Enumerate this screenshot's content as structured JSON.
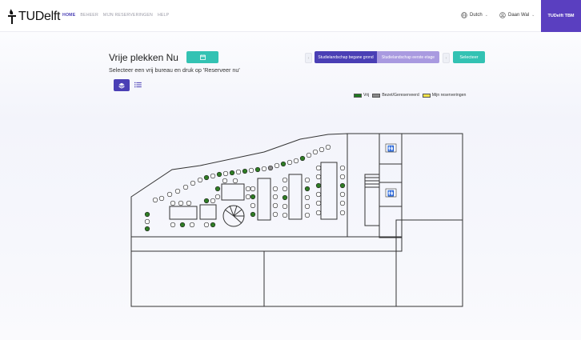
{
  "brand": {
    "name": "TUDelft"
  },
  "nav": {
    "links": [
      "HOME",
      "BEHEER",
      "MIJN RESERVERINGEN",
      "HELP"
    ],
    "language": "Dutch",
    "user": "Daan Wal",
    "tenant": "TUDelft TBM"
  },
  "page": {
    "title": "Vrije plekken Nu",
    "subtitle": "Selecteer een vrij bureau en druk op 'Reserveer nu'",
    "floors": [
      "Studielandschap begane grond",
      "Studielandschap eerste etage"
    ],
    "select_label": "Selecteer"
  },
  "legend": [
    {
      "label": "Vrij",
      "color": "#1f7a1f"
    },
    {
      "label": "Bezet/Gereserveerd",
      "color": "#8a8a8a"
    },
    {
      "label": "Mijn reserveringen",
      "color": "#f2e34a"
    }
  ],
  "icons": {
    "calendar": "calendar-icon",
    "layers": "layers-icon",
    "list": "list-icon",
    "globe": "globe-icon",
    "user": "user-circle-icon"
  }
}
